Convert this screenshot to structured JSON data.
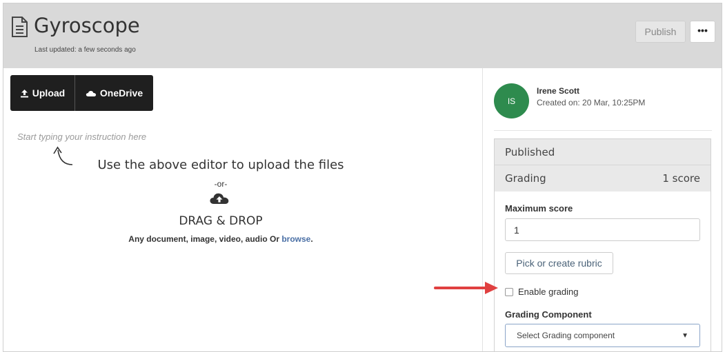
{
  "header": {
    "title": "Gyroscope",
    "last_updated": "Last updated: a few seconds ago",
    "publish_label": "Publish",
    "more_label": "•••",
    "doc_icon": "document-icon"
  },
  "editor": {
    "toolbar": {
      "upload_label": "Upload",
      "onedrive_label": "OneDrive",
      "upload_icon": "upload-icon",
      "onedrive_icon": "cloud-icon"
    },
    "placeholder": "Start typing your instruction here",
    "instruction": "Use the above editor to upload the files",
    "or_text": "-or-",
    "drag_drop": "DRAG & DROP",
    "accepted_prefix": "Any document, image, video, audio Or",
    "browse_link": "browse",
    "accepted_suffix": "."
  },
  "sidebar": {
    "avatar_initials": "IS",
    "avatar_color": "#2e8b4e",
    "author": "Irene Scott",
    "created": "Created on: 20 Mar, 10:25PM",
    "published_label": "Published",
    "grading_label": "Grading",
    "grading_score": "1 score",
    "max_score_label": "Maximum score",
    "max_score_value": "1",
    "rubric_label": "Pick or create rubric",
    "enable_grading_label": "Enable grading",
    "enable_grading_checked": false,
    "component_label": "Grading Component",
    "component_select": "Select Grading component"
  },
  "colors": {
    "header_bg": "#d9d9d9",
    "toolbar_bg": "#1f1f1f",
    "link": "#4a6fa5",
    "annotation_arrow": "#e04040"
  }
}
